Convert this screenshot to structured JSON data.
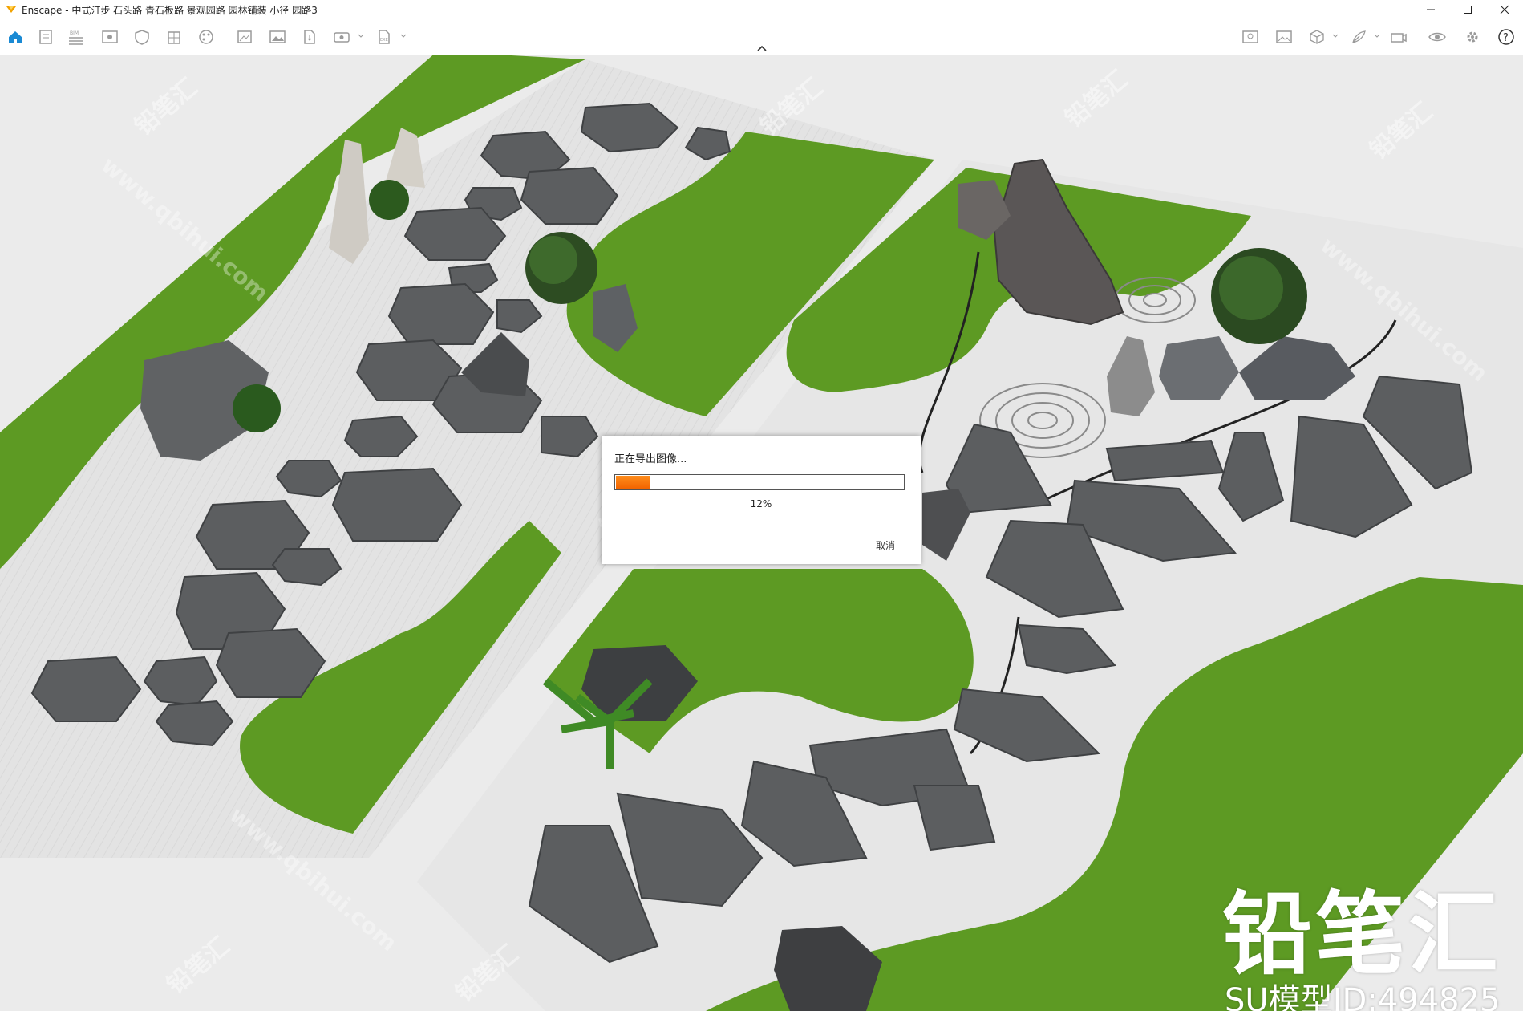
{
  "window": {
    "title": "Enscape - 中式汀步 石头路 青石板路 景观园路 园林铺装 小径 园路3",
    "controls": [
      "minimize-icon",
      "maximize-icon",
      "close-icon"
    ]
  },
  "toolbar": {
    "left_icons": [
      "home-icon",
      "document-icon",
      "bim-icon",
      "eye-panel-icon",
      "shield-icon",
      "building-icon",
      "palette-icon",
      "scene-icon",
      "image-icon",
      "file-export-icon",
      "panorama-icon",
      "exe-export-icon"
    ],
    "right_icons": [
      "map-icon",
      "gallery-icon",
      "cube-icon",
      "feather-icon",
      "camera-icon",
      "visibility-icon",
      "settings-icon",
      "help-icon"
    ],
    "bim_label": "BIM",
    "exe_label": "EXE",
    "help_label": "?"
  },
  "colors": {
    "accent": "#1a8ad4",
    "progress": "#f26400",
    "grass": "#5d9a23",
    "gravel": "#e4e4e4",
    "stone": "#5c5e60"
  },
  "dialog": {
    "title": "正在导出图像...",
    "progress_value": 0.12,
    "progress_label": "12%",
    "cancel_label": "取消"
  },
  "watermark": {
    "brand": "铅笔汇",
    "model_id": "SU模型ID:494825",
    "url_text": "www.qbihui.com"
  }
}
